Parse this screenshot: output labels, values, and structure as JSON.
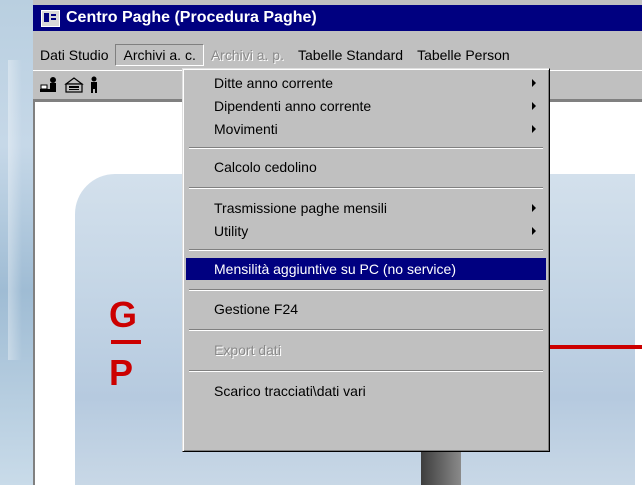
{
  "window": {
    "title": "Centro Paghe (Procedura Paghe)"
  },
  "menu_bar": [
    {
      "label": "Dati Studio",
      "state": "normal"
    },
    {
      "label": "Archivi a. c.",
      "state": "open"
    },
    {
      "label": "Archivi a. p.",
      "state": "disabled"
    },
    {
      "label": "Tabelle Standard",
      "state": "normal"
    },
    {
      "label": "Tabelle Person",
      "state": "normal"
    }
  ],
  "toolbar": {
    "icons": [
      "user-desk-icon",
      "cashier-icon",
      "person-icon"
    ]
  },
  "dropdown": {
    "items": [
      {
        "label": "Ditte anno corrente",
        "submenu": true
      },
      {
        "label": "Dipendenti anno corrente",
        "submenu": true
      },
      {
        "label": "Movimenti",
        "submenu": true
      },
      {
        "label": "Calcolo cedolino",
        "submenu": false
      },
      {
        "label": "Trasmissione paghe mensili",
        "submenu": true
      },
      {
        "label": "Utility",
        "submenu": true
      },
      {
        "label": "Mensilità aggiuntive su PC (no service)",
        "submenu": false,
        "selected": true
      },
      {
        "label": "Gestione F24",
        "submenu": false
      },
      {
        "label": "Export dati",
        "submenu": false,
        "disabled": true
      },
      {
        "label": "Scarico tracciati\\dati vari",
        "submenu": false
      }
    ]
  },
  "splash": {
    "letter_1": "G",
    "letter_2": "P"
  },
  "colors": {
    "title_bar": "#000080",
    "menu_face": "#c0c0c0",
    "selection": "#000080",
    "logo_red": "#cc0000"
  }
}
